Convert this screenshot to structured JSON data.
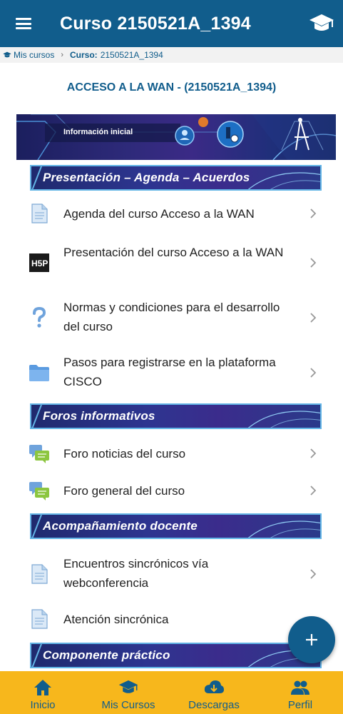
{
  "header": {
    "title": "Curso 2150521A_1394",
    "menu_icon": "hamburger-icon",
    "right_icon": "graduation-cap-icon"
  },
  "breadcrumb": {
    "home_label": "Mis cursos",
    "current_prefix": "Curso:",
    "current_value": "2150521A_1394"
  },
  "course": {
    "title": "ACCESO A LA WAN - (2150521A_1394)"
  },
  "banner": {
    "label": "Información inicial"
  },
  "sections": [
    {
      "heading": "Presentación – Agenda – Acuerdos",
      "items": [
        {
          "label": "Agenda del curso Acceso a la WAN",
          "icon": "page-icon"
        },
        {
          "label": "Presentación del curso Acceso a la WAN",
          "icon": "h5p-icon"
        },
        {
          "label": "Normas y condiciones para el desarrollo del curso",
          "icon": "question-icon"
        },
        {
          "label": "Pasos para registrarse en la plataforma CISCO",
          "icon": "folder-icon"
        }
      ]
    },
    {
      "heading": "Foros informativos",
      "items": [
        {
          "label": "Foro noticias del curso",
          "icon": "forum-icon"
        },
        {
          "label": "Foro general del curso",
          "icon": "forum-icon"
        }
      ]
    },
    {
      "heading": "Acompañamiento docente",
      "items": [
        {
          "label": "Encuentros sincrónicos vía webconferencia",
          "icon": "page-icon"
        },
        {
          "label": "Atención sincrónica",
          "icon": "page-icon"
        }
      ]
    },
    {
      "heading": "Componente práctico",
      "items": []
    }
  ],
  "fab": {
    "icon": "plus-icon"
  },
  "bottom_nav": [
    {
      "label": "Inicio",
      "icon": "home-icon"
    },
    {
      "label": "Mis Cursos",
      "icon": "graduation-cap-icon"
    },
    {
      "label": "Descargas",
      "icon": "cloud-download-icon"
    },
    {
      "label": "Perfil",
      "icon": "people-icon"
    }
  ],
  "colors": {
    "primary": "#115d8c",
    "accent": "#f7b71c",
    "section_border": "#63b5e6",
    "breadcrumb_bg": "#f2f2f2"
  }
}
